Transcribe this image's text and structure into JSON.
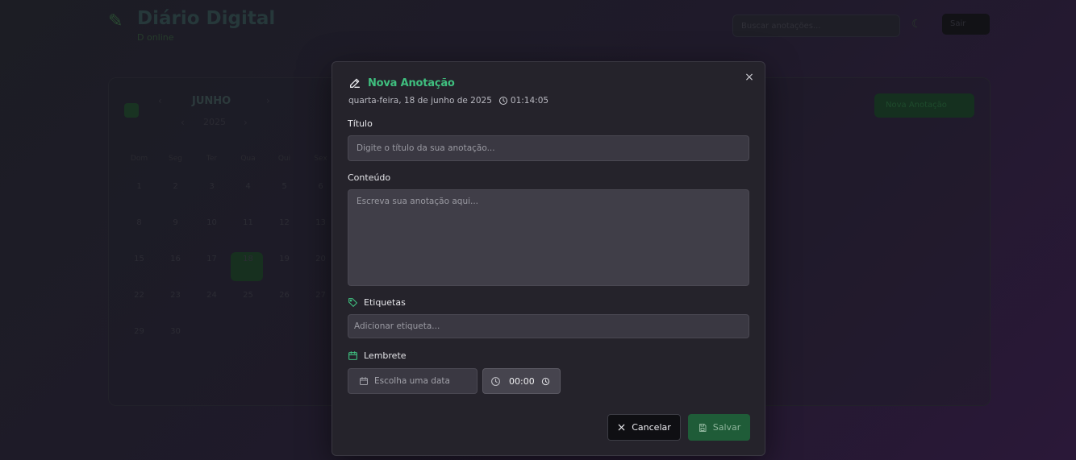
{
  "background": {
    "app_title": "Diário Digital",
    "app_subtitle": "D online",
    "search_placeholder": "Buscar anotações...",
    "user_button": "Sair",
    "new_note_button": "Nova Anotação",
    "month": "JUNHO",
    "year": "2025",
    "weekdays": [
      "Dom",
      "Seg",
      "Ter",
      "Qua",
      "Qui",
      "Sex"
    ],
    "days": [
      "1",
      "2",
      "3",
      "4",
      "5",
      "6",
      "8",
      "9",
      "10",
      "11",
      "12",
      "13",
      "15",
      "16",
      "17",
      "18",
      "19",
      "20",
      "22",
      "23",
      "24",
      "25",
      "26",
      "27",
      "29",
      "30"
    ]
  },
  "modal": {
    "title": "Nova Anotação",
    "date_text": "quarta-feira, 18 de junho de 2025",
    "time_text": "01:14:05",
    "close_symbol": "×",
    "title_label": "Título",
    "title_placeholder": "Digite o título da sua anotação...",
    "content_label": "Conteúdo",
    "content_placeholder": "Escreva sua anotação aqui...",
    "tags_label": "Etiquetas",
    "tags_placeholder": "Adicionar etiqueta...",
    "reminder_label": "Lembrete",
    "date_picker_placeholder": "Escolha uma data",
    "reminder_time": "00:00",
    "cancel_label": "Cancelar",
    "save_label": "Salvar"
  },
  "colors": {
    "accent": "#3fbf7f",
    "save_button": "#1f5c38",
    "modal_bg": "#25232b"
  },
  "icons": [
    "pencil-icon",
    "clock-icon",
    "close-icon",
    "tag-icon",
    "calendar-icon",
    "x-icon",
    "save-icon"
  ]
}
